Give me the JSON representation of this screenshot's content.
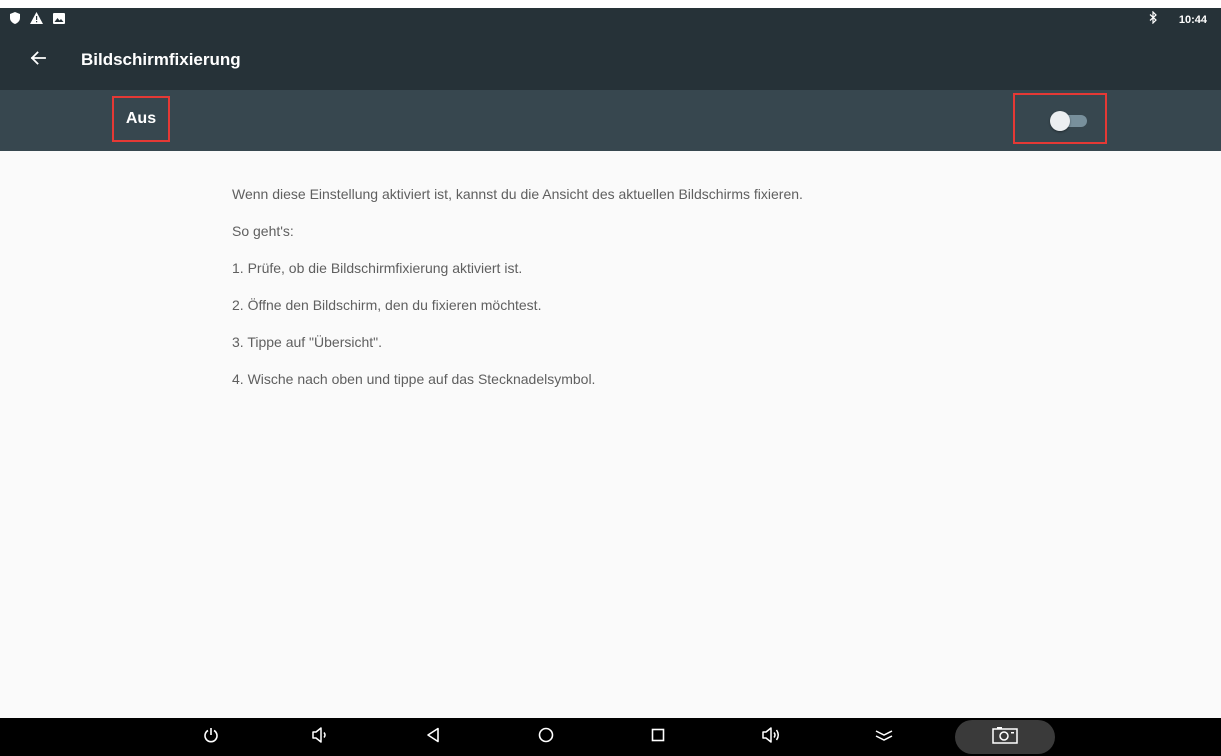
{
  "status_bar": {
    "time": "10:44",
    "left_icons": [
      "shield-icon",
      "warning-icon",
      "image-icon"
    ],
    "right_icons": [
      "bluetooth-icon"
    ]
  },
  "app_bar": {
    "title": "Bildschirmfixierung",
    "back_icon": "arrow-left-icon"
  },
  "toggle": {
    "label": "Aus",
    "state": false
  },
  "content": {
    "description": "Wenn diese Einstellung aktiviert ist, kannst du die Ansicht des aktuellen Bildschirms fixieren.",
    "howto_heading": "So geht's:",
    "steps": [
      "1. Prüfe, ob die Bildschirmfixierung aktiviert ist.",
      "2. Öffne den Bildschirm, den du fixieren möchtest.",
      "3. Tippe auf \"Übersicht\".",
      "4. Wische nach oben und tippe auf das Stecknadelsymbol."
    ]
  },
  "nav_bar": {
    "buttons": [
      "power-icon",
      "volume-down-icon",
      "back-triangle-icon",
      "home-circle-icon",
      "recents-square-icon",
      "volume-up-icon",
      "collapse-icon",
      "screenshot-icon"
    ]
  },
  "colors": {
    "app_bar": "#263238",
    "toggle_bar": "#37474f",
    "background": "#fafafa",
    "highlight": "#e53935"
  }
}
